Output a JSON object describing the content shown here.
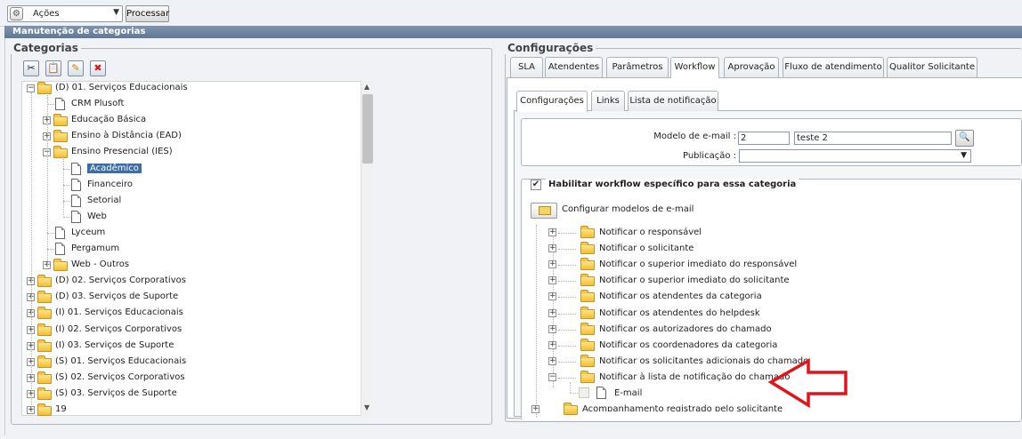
{
  "toolbar": {
    "actions_value": "Ações",
    "process_label": "Processar"
  },
  "window": {
    "title": "Manutenção de categorias"
  },
  "categories": {
    "legend": "Categorias",
    "tools": [
      "cut-icon",
      "paste-icon",
      "edit-icon",
      "delete-icon"
    ],
    "tree": [
      {
        "label": "(D) 01. Serviços Educacionais",
        "level": 0,
        "type": "folder",
        "expanded": true
      },
      {
        "label": "CRM Plusoft",
        "level": 1,
        "type": "doc"
      },
      {
        "label": "Educação Básica",
        "level": 1,
        "type": "folder",
        "expanded": false
      },
      {
        "label": "Ensino à Distância (EAD)",
        "level": 1,
        "type": "folder",
        "expanded": false
      },
      {
        "label": "Ensino Presencial (IES)",
        "level": 1,
        "type": "folder",
        "expanded": true
      },
      {
        "label": "Acadêmico",
        "level": 2,
        "type": "doc",
        "selected": true
      },
      {
        "label": "Financeiro",
        "level": 2,
        "type": "doc"
      },
      {
        "label": "Setorial",
        "level": 2,
        "type": "doc"
      },
      {
        "label": "Web",
        "level": 2,
        "type": "doc"
      },
      {
        "label": "Lyceum",
        "level": 1,
        "type": "doc"
      },
      {
        "label": "Pergamum",
        "level": 1,
        "type": "doc"
      },
      {
        "label": "Web - Outros",
        "level": 1,
        "type": "folder",
        "expanded": false
      },
      {
        "label": "(D) 02. Serviços Corporativos",
        "level": 0,
        "type": "folder",
        "expanded": false
      },
      {
        "label": "(D) 03. Serviços de Suporte",
        "level": 0,
        "type": "folder",
        "expanded": false
      },
      {
        "label": "(I) 01. Serviços Educacionais",
        "level": 0,
        "type": "folder",
        "expanded": false
      },
      {
        "label": "(I) 02. Serviços Corporativos",
        "level": 0,
        "type": "folder",
        "expanded": false
      },
      {
        "label": "(I) 03. Serviços de Suporte",
        "level": 0,
        "type": "folder",
        "expanded": false
      },
      {
        "label": "(S) 01. Serviços Educacionais",
        "level": 0,
        "type": "folder",
        "expanded": false
      },
      {
        "label": "(S) 02. Serviços Corporativos",
        "level": 0,
        "type": "folder",
        "expanded": false
      },
      {
        "label": "(S) 03. Serviços de Suporte",
        "level": 0,
        "type": "folder",
        "expanded": false
      },
      {
        "label": "19",
        "level": 0,
        "type": "folder",
        "expanded": false
      }
    ]
  },
  "config": {
    "legend": "Configurações",
    "tabs": [
      "SLA",
      "Atendentes",
      "Parâmetros",
      "Workflow",
      "Aprovação",
      "Fluxo de atendimento",
      "Qualitor Solicitante"
    ],
    "active_tab": "Workflow",
    "subtabs": [
      "Configurações",
      "Links",
      "Lista de notificação"
    ],
    "active_subtab": "Configurações",
    "email_model_label": "Modelo de e-mail :",
    "email_model_code": "2",
    "email_model_name": "teste 2",
    "publication_label": "Publicação :",
    "publication_value": "",
    "workflow_checkbox_label": "Habilitar workflow específico para essa categoria",
    "configure_button_label": "Configurar modelos de e-mail",
    "notify_tree": [
      "Notificar o responsável",
      "Notificar o solicitante",
      "Notificar o superior imediato do responsável",
      "Notificar o superior imediato do solicitante",
      "Notificar os atendentes da categoria",
      "Notificar os atendentes do helpdesk",
      "Notificar os autorizadores do chamado",
      "Notificar os coordenadores da categoria",
      "Notificar os solicitantes adicionais do chamado",
      "Notificar à lista de notificação do chamado"
    ],
    "email_child": "E-mail",
    "last_item": "Acompanhamento registrado pelo solicitante"
  },
  "colors": {
    "annotation_arrow": "#e0141b",
    "selection": "#3a6ea5",
    "titlebar": "#6b829c"
  }
}
